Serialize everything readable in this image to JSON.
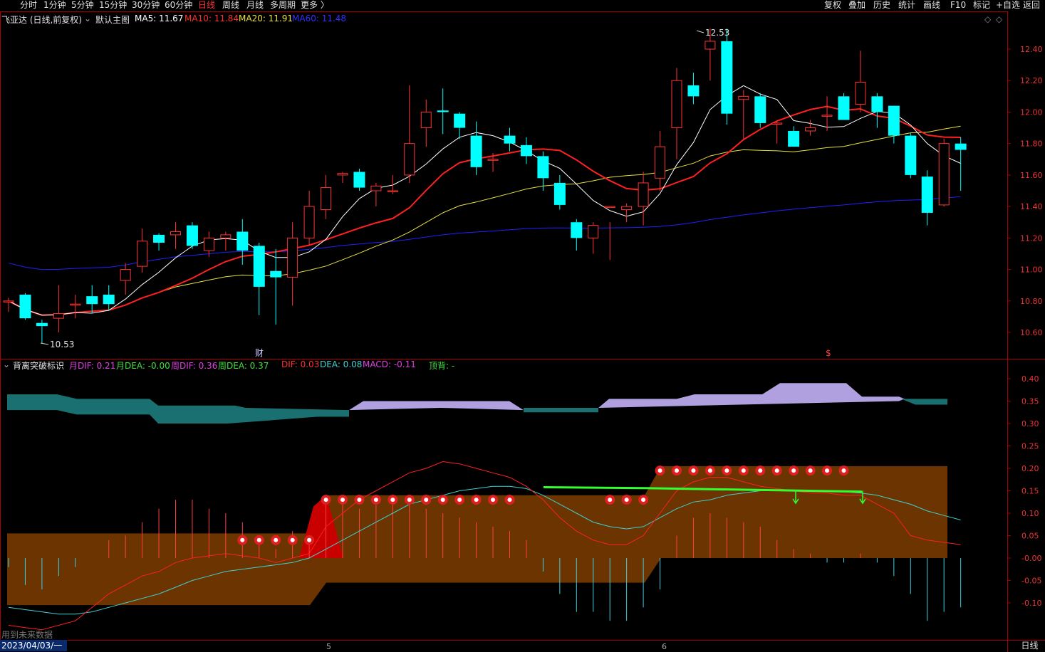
{
  "topbar": {
    "periods": [
      "分时",
      "1分钟",
      "5分钟",
      "15分钟",
      "30分钟",
      "60分钟",
      "日线",
      "周线",
      "月线",
      "多周期",
      "更多 〉"
    ],
    "active_period": "日线",
    "tools": [
      "复权",
      "叠加",
      "历史",
      "统计",
      "画线",
      "F10",
      "标记",
      "+自选",
      "返回"
    ]
  },
  "main": {
    "stock_label": "飞亚达 (日线,前复权)",
    "template_label": "默认主图",
    "ma5": "MA5: 11.67",
    "ma10": "MA10: 11.84",
    "ma20": "MA20: 11.91",
    "ma60": "MA60: 11.48",
    "high_label": "12.53",
    "low_label": "10.53",
    "cai_marker": "财",
    "s_marker": "$",
    "y_ticks": [
      "12.40",
      "12.20",
      "12.00",
      "11.80",
      "11.60",
      "11.40",
      "11.20",
      "11.00",
      "10.80",
      "10.60"
    ]
  },
  "macd": {
    "indicator_name": "背离突破标识",
    "m_dif": "月DIF: 0.21",
    "m_dea": "月DEA: -0.00",
    "w_dif": "周DIF: 0.36",
    "w_dea": "周DEA: 0.37",
    "dif": "DIF: 0.03",
    "dea": "DEA: 0.08",
    "macd": "MACD: -0.11",
    "top_div": "顶背: -",
    "y_ticks": [
      "0.40",
      "0.35",
      "0.30",
      "0.25",
      "0.20",
      "0.15",
      "0.10",
      "0.05",
      "-0.00",
      "-0.05",
      "-0.10"
    ]
  },
  "bottom": {
    "date": "2023/04/03/一",
    "period": "日线",
    "future_note": "用到未来数据",
    "month_marks": [
      "5",
      "6"
    ]
  },
  "colors": {
    "up": "#ff3232",
    "down": "#00ffff",
    "ma5": "#ffffff",
    "ma10": "#ff2020",
    "ma20": "#e8e040",
    "ma60": "#2020ff"
  },
  "chart_data": {
    "type": "candlestick",
    "candles": [
      {
        "o": 10.8,
        "h": 10.82,
        "l": 10.73,
        "c": 10.8
      },
      {
        "o": 10.84,
        "h": 10.85,
        "l": 10.68,
        "c": 10.69
      },
      {
        "o": 10.66,
        "h": 10.68,
        "l": 10.53,
        "c": 10.64
      },
      {
        "o": 10.69,
        "h": 10.9,
        "l": 10.6,
        "c": 10.72
      },
      {
        "o": 10.78,
        "h": 10.84,
        "l": 10.69,
        "c": 10.78
      },
      {
        "o": 10.83,
        "h": 10.9,
        "l": 10.72,
        "c": 10.78
      },
      {
        "o": 10.84,
        "h": 10.9,
        "l": 10.74,
        "c": 10.78
      },
      {
        "o": 10.93,
        "h": 11.04,
        "l": 10.84,
        "c": 11.0
      },
      {
        "o": 11.02,
        "h": 11.26,
        "l": 10.98,
        "c": 11.18
      },
      {
        "o": 11.22,
        "h": 11.23,
        "l": 11.12,
        "c": 11.17
      },
      {
        "o": 11.22,
        "h": 11.3,
        "l": 11.13,
        "c": 11.24
      },
      {
        "o": 11.28,
        "h": 11.3,
        "l": 11.13,
        "c": 11.15
      },
      {
        "o": 11.12,
        "h": 11.24,
        "l": 11.08,
        "c": 11.2
      },
      {
        "o": 11.2,
        "h": 11.24,
        "l": 11.12,
        "c": 11.22
      },
      {
        "o": 11.24,
        "h": 11.32,
        "l": 11.03,
        "c": 11.12
      },
      {
        "o": 11.15,
        "h": 11.17,
        "l": 10.71,
        "c": 10.89
      },
      {
        "o": 10.99,
        "h": 11.13,
        "l": 10.65,
        "c": 10.95
      },
      {
        "o": 10.95,
        "h": 11.3,
        "l": 10.77,
        "c": 11.2
      },
      {
        "o": 11.2,
        "h": 11.5,
        "l": 11.15,
        "c": 11.4
      },
      {
        "o": 11.38,
        "h": 11.6,
        "l": 11.32,
        "c": 11.52
      },
      {
        "o": 11.6,
        "h": 11.62,
        "l": 11.55,
        "c": 11.61
      },
      {
        "o": 11.62,
        "h": 11.64,
        "l": 11.5,
        "c": 11.52
      },
      {
        "o": 11.5,
        "h": 11.55,
        "l": 11.4,
        "c": 11.53
      },
      {
        "o": 11.5,
        "h": 11.6,
        "l": 11.48,
        "c": 11.5
      },
      {
        "o": 11.6,
        "h": 12.17,
        "l": 11.55,
        "c": 11.8
      },
      {
        "o": 11.9,
        "h": 12.08,
        "l": 11.78,
        "c": 12.0
      },
      {
        "o": 12.01,
        "h": 12.15,
        "l": 11.86,
        "c": 12.0
      },
      {
        "o": 11.99,
        "h": 12.0,
        "l": 11.83,
        "c": 11.9
      },
      {
        "o": 11.85,
        "h": 11.94,
        "l": 11.6,
        "c": 11.65
      },
      {
        "o": 11.7,
        "h": 11.74,
        "l": 11.62,
        "c": 11.7
      },
      {
        "o": 11.85,
        "h": 11.9,
        "l": 11.75,
        "c": 11.8
      },
      {
        "o": 11.79,
        "h": 11.84,
        "l": 11.67,
        "c": 11.72
      },
      {
        "o": 11.72,
        "h": 11.75,
        "l": 11.5,
        "c": 11.58
      },
      {
        "o": 11.55,
        "h": 11.6,
        "l": 11.38,
        "c": 11.41
      },
      {
        "o": 11.3,
        "h": 11.32,
        "l": 11.12,
        "c": 11.2
      },
      {
        "o": 11.2,
        "h": 11.3,
        "l": 11.1,
        "c": 11.28
      },
      {
        "o": 11.4,
        "h": 11.3,
        "l": 11.06,
        "c": 11.4
      },
      {
        "o": 11.38,
        "h": 11.42,
        "l": 11.3,
        "c": 11.4
      },
      {
        "o": 11.4,
        "h": 11.62,
        "l": 11.28,
        "c": 11.55
      },
      {
        "o": 11.58,
        "h": 11.88,
        "l": 11.5,
        "c": 11.78
      },
      {
        "o": 11.9,
        "h": 12.28,
        "l": 11.7,
        "c": 12.2
      },
      {
        "o": 12.17,
        "h": 12.25,
        "l": 12.05,
        "c": 12.1
      },
      {
        "o": 12.4,
        "h": 12.53,
        "l": 12.2,
        "c": 12.45
      },
      {
        "o": 12.45,
        "h": 12.53,
        "l": 11.92,
        "c": 11.99
      },
      {
        "o": 12.08,
        "h": 12.14,
        "l": 11.83,
        "c": 12.1
      },
      {
        "o": 12.1,
        "h": 12.12,
        "l": 11.9,
        "c": 11.93
      },
      {
        "o": 11.93,
        "h": 11.94,
        "l": 11.8,
        "c": 11.93
      },
      {
        "o": 11.88,
        "h": 11.91,
        "l": 11.79,
        "c": 11.78
      },
      {
        "o": 11.88,
        "h": 11.95,
        "l": 11.85,
        "c": 11.9
      },
      {
        "o": 11.98,
        "h": 12.1,
        "l": 11.88,
        "c": 11.98
      },
      {
        "o": 12.1,
        "h": 12.12,
        "l": 11.95,
        "c": 11.95
      },
      {
        "o": 12.05,
        "h": 12.39,
        "l": 12.0,
        "c": 12.19
      },
      {
        "o": 12.1,
        "h": 12.12,
        "l": 11.9,
        "c": 12.0
      },
      {
        "o": 12.04,
        "h": 12.04,
        "l": 11.8,
        "c": 11.85
      },
      {
        "o": 11.85,
        "h": 11.87,
        "l": 11.58,
        "c": 11.6
      },
      {
        "o": 11.59,
        "h": 11.63,
        "l": 11.28,
        "c": 11.36
      },
      {
        "o": 11.41,
        "h": 11.83,
        "l": 11.4,
        "c": 11.8
      },
      {
        "o": 11.8,
        "h": 11.84,
        "l": 11.5,
        "c": 11.76
      }
    ],
    "ylim": [
      10.5,
      12.55
    ]
  }
}
